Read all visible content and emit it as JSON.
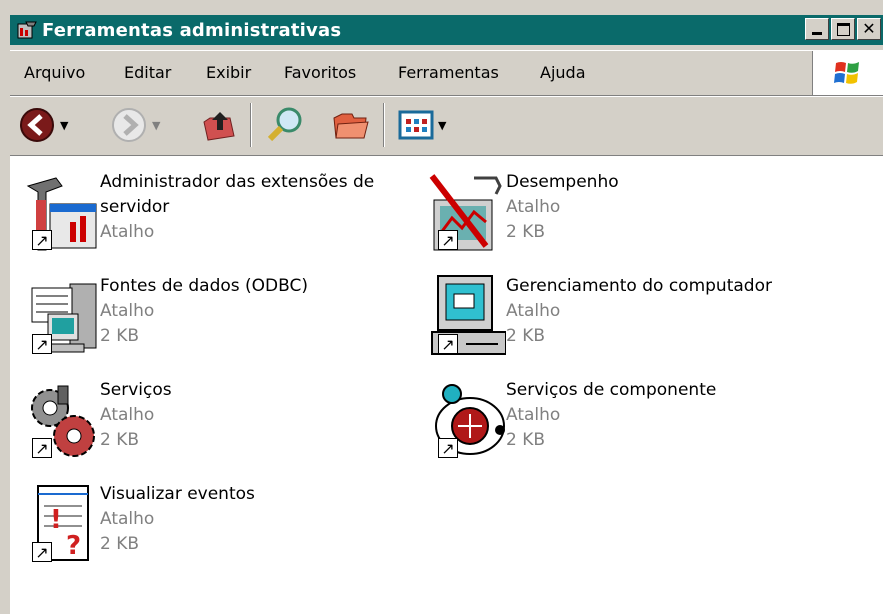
{
  "window": {
    "title": "Ferramentas administrativas"
  },
  "menu": [
    "Arquivo",
    "Editar",
    "Exibir",
    "Favoritos",
    "Ferramentas",
    "Ajuda"
  ],
  "items": [
    {
      "name": "Administrador das extensões de servidor",
      "type": "Atalho",
      "size": ""
    },
    {
      "name": "Desempenho",
      "type": "Atalho",
      "size": "2 KB"
    },
    {
      "name": "Fontes de dados (ODBC)",
      "type": "Atalho",
      "size": "2 KB"
    },
    {
      "name": "Gerenciamento do computador",
      "type": "Atalho",
      "size": "2 KB"
    },
    {
      "name": "Serviços",
      "type": "Atalho",
      "size": "2 KB"
    },
    {
      "name": "Serviços de componente",
      "type": "Atalho",
      "size": "2 KB"
    },
    {
      "name": "Visualizar eventos",
      "type": "Atalho",
      "size": "2 KB"
    }
  ],
  "colors": {
    "titlebar": "#0a6a6a",
    "face": "#d4d0c8",
    "subtext": "#808080"
  }
}
